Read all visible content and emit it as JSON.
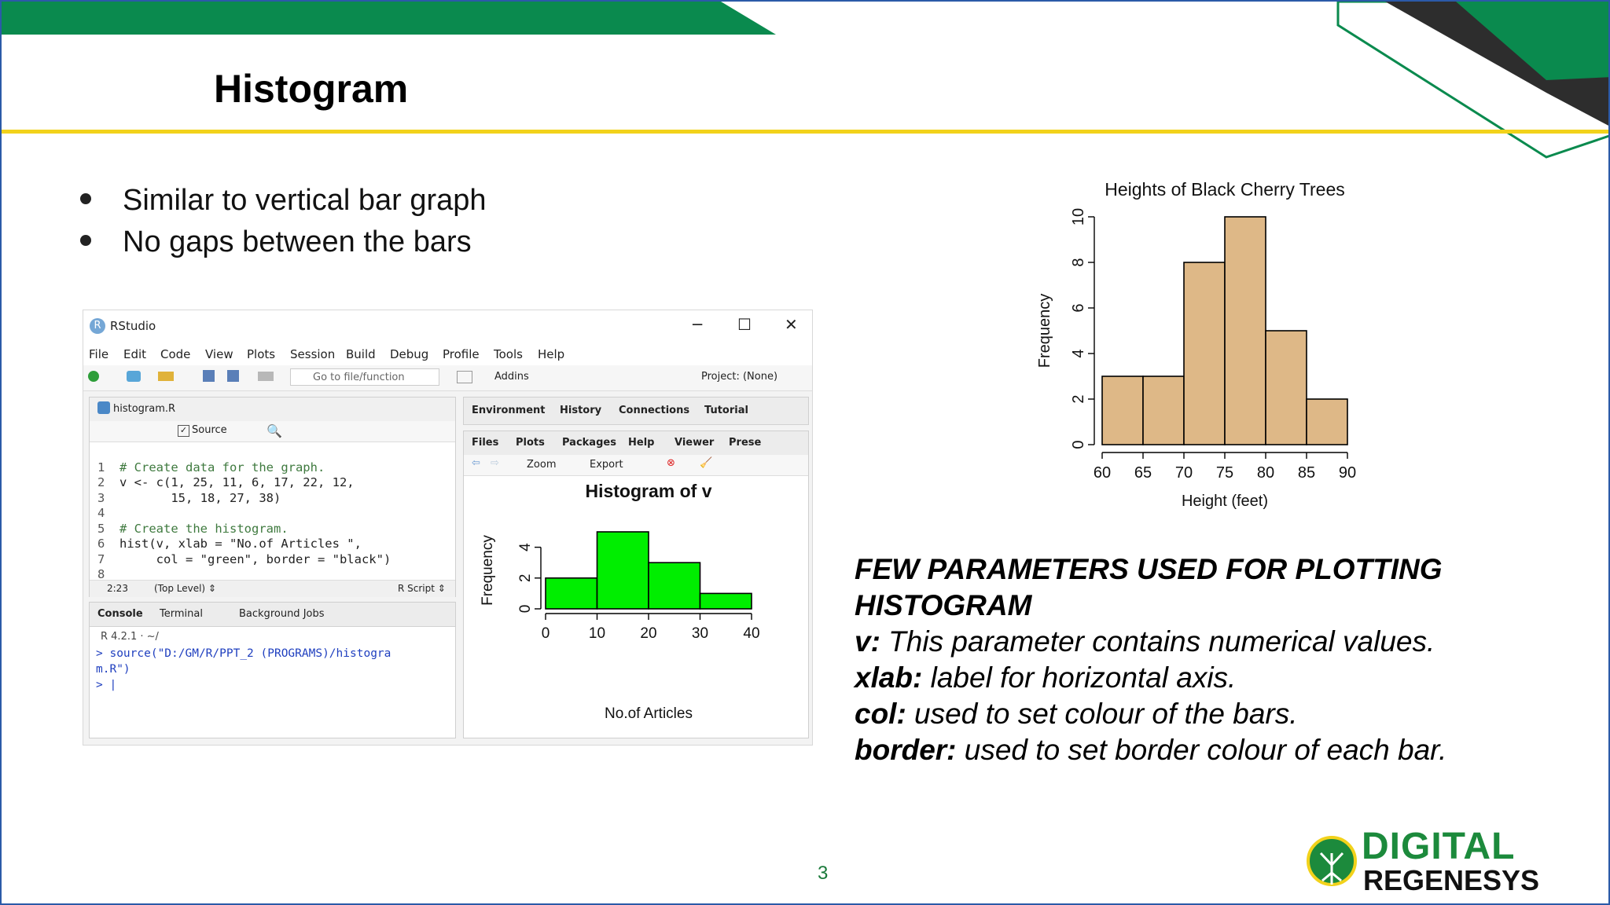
{
  "slide": {
    "title": "Histogram",
    "bullets": [
      "Similar to vertical bar graph",
      "No gaps between the bars"
    ],
    "page_number": "3",
    "logo": {
      "line1": "DIGITAL",
      "line2": "REGENESYS"
    },
    "colors": {
      "green": "#0a8a4e",
      "yellow": "#f2d21b",
      "dark": "#2d2d2d"
    }
  },
  "rstudio": {
    "window_title": "RStudio",
    "window_controls": {
      "minimize": "─",
      "maximize": "☐",
      "close": "✕"
    },
    "menu": [
      "File",
      "Edit",
      "Code",
      "View",
      "Plots",
      "Session",
      "Build",
      "Debug",
      "Profile",
      "Tools",
      "Help"
    ],
    "toolbar": {
      "goto_placeholder": "Go to file/function",
      "addins": "Addins",
      "project": "Project: (None)"
    },
    "editor": {
      "tab": "histogram.R",
      "source_label": "Source",
      "lines": [
        {
          "n": "1",
          "text": "# Create data for the graph."
        },
        {
          "n": "2",
          "text": "v <- c(1, 25, 11, 6, 17, 22, 12,"
        },
        {
          "n": "3",
          "text": "       15, 18, 27, 38)"
        },
        {
          "n": "4",
          "text": ""
        },
        {
          "n": "5",
          "text": "# Create the histogram."
        },
        {
          "n": "6",
          "text": "hist(v, xlab = \"No.of Articles \","
        },
        {
          "n": "7",
          "text": "     col = \"green\", border = \"black\")"
        },
        {
          "n": "8",
          "text": ""
        }
      ],
      "status_pos": "2:23",
      "status_level": "(Top Level) ⇕",
      "status_type": "R Script ⇕"
    },
    "console": {
      "tabs": [
        "Console",
        "Terminal",
        "Background Jobs"
      ],
      "version": "R 4.2.1 · ~/",
      "line1": "> source(\"D:/GM/R/PPT_2 (PROGRAMS)/histogra",
      "line2": "m.R\")",
      "prompt": "> |"
    },
    "env_tabs": [
      "Environment",
      "History",
      "Connections",
      "Tutorial"
    ],
    "files_tabs": [
      "Files",
      "Plots",
      "Packages",
      "Help",
      "Viewer",
      "Prese"
    ],
    "plots_toolbar": {
      "zoom": "Zoom",
      "export": "Export"
    }
  },
  "chart_data": [
    {
      "type": "bar",
      "title": "Histogram of v",
      "xlabel": "No.of Articles",
      "ylabel": "Frequency",
      "bins": [
        [
          0,
          10
        ],
        [
          10,
          20
        ],
        [
          20,
          30
        ],
        [
          30,
          40
        ]
      ],
      "values": [
        2,
        5,
        3,
        1
      ],
      "xticks": [
        "0",
        "10",
        "20",
        "30",
        "40"
      ],
      "yticks": [
        "0",
        "2",
        "4"
      ],
      "ylim": [
        0,
        5
      ],
      "bar_color": "#00ee00",
      "border_color": "#000000"
    },
    {
      "type": "bar",
      "title": "Heights of Black Cherry Trees",
      "xlabel": "Height (feet)",
      "ylabel": "Frequency",
      "bins": [
        [
          60,
          65
        ],
        [
          65,
          70
        ],
        [
          70,
          75
        ],
        [
          75,
          80
        ],
        [
          80,
          85
        ],
        [
          85,
          90
        ]
      ],
      "values": [
        3,
        3,
        8,
        10,
        5,
        2
      ],
      "xticks": [
        "60",
        "65",
        "70",
        "75",
        "80",
        "85",
        "90"
      ],
      "yticks": [
        "0",
        "2",
        "4",
        "6",
        "8",
        "10"
      ],
      "ylim": [
        0,
        10
      ],
      "bar_color": "#deb887",
      "border_color": "#000000"
    }
  ],
  "params": {
    "heading_line1": "FEW PARAMETERS USED FOR PLOTTING",
    "heading_line2": "HISTOGRAM",
    "items": [
      {
        "key": "v:",
        "desc": " This parameter contains numerical values."
      },
      {
        "key": "xlab:",
        "desc": " label for horizontal axis."
      },
      {
        "key": "col:",
        "desc": " used to set colour of the bars."
      },
      {
        "key": "border:",
        "desc": " used to set border colour of each bar."
      }
    ]
  }
}
